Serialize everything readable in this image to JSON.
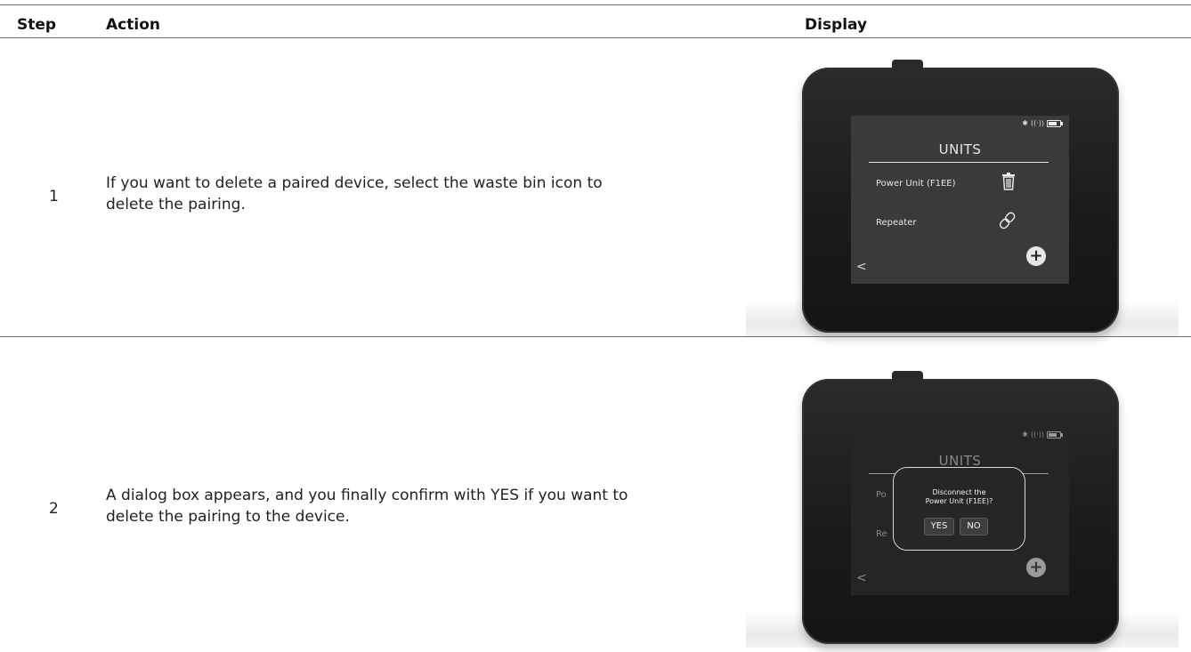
{
  "header": {
    "step": "Step",
    "action": "Action",
    "display": "Display"
  },
  "rows": [
    {
      "step": "1",
      "action": "If you want to delete a paired device, select the waste bin icon to delete the pairing.",
      "screen": {
        "title": "UNITS",
        "items": [
          {
            "label": "Power Unit (F1EE)",
            "icon": "trash-icon"
          },
          {
            "label": "Repeater",
            "icon": "link-icon"
          }
        ],
        "back": "<",
        "add": "+"
      }
    },
    {
      "step": "2",
      "action": "A dialog box appears, and you finally confirm with YES if you want to delete the pairing to the device.",
      "screen": {
        "title": "UNITS",
        "items": [
          {
            "label": "Po"
          },
          {
            "label": "Re"
          }
        ],
        "back": "<",
        "add": "+",
        "dialog": {
          "line1": "Disconnect the",
          "line2": "Power Unit (F1EE)?",
          "yes": "YES",
          "no": "NO"
        }
      }
    }
  ]
}
